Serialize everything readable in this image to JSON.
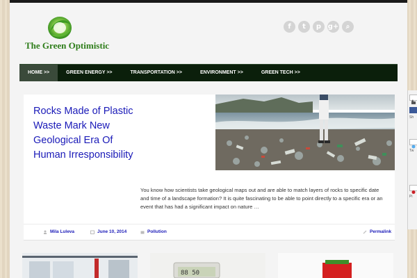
{
  "header": {
    "site_name": "The Green Optimistic",
    "social_icons": [
      "facebook-icon",
      "twitter-icon",
      "pinterest-icon",
      "google-plus-icon",
      "search-icon"
    ],
    "social_glyphs": [
      "f",
      "t",
      "p",
      "g+",
      "⌕"
    ]
  },
  "nav": {
    "items": [
      {
        "label": "HOME >>",
        "active": true
      },
      {
        "label": "GREEN ENERGY >>",
        "active": false
      },
      {
        "label": "TRANSPORTATION >>",
        "active": false
      },
      {
        "label": "ENVIRONMENT >>",
        "active": false
      },
      {
        "label": "GREEN TECH >>",
        "active": false
      }
    ]
  },
  "featured": {
    "title": "Rocks Made of Plastic Waste Mark New Geological Era Of Human Irresponsibility",
    "excerpt": "You know how scientists take geological maps out and are able to match layers of rocks to specific date and time of a landscape formation? It is quite fascinating to be able to point directly to a specific era or an event that has had a significant impact on nature …",
    "author": "Mila Luleva",
    "date": "June 10, 2014",
    "category": "Pollution",
    "permalink": "Permalink"
  },
  "share": {
    "labels": [
      "Sh",
      "Tw",
      "Pi"
    ]
  },
  "colors": {
    "nav_bg": "#0b1f0b",
    "title_link": "#1a1ab8",
    "brand_green": "#2e7d1a",
    "page_bg": "#f4f4f4"
  }
}
